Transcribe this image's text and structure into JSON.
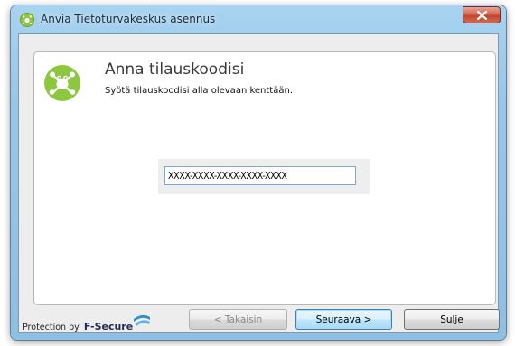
{
  "window": {
    "title": "Anvia Tietoturvakeskus asennus"
  },
  "content": {
    "heading": "Anna tilauskoodisi",
    "subheading": "Syötä tilauskoodisi alla olevaan kenttään.",
    "code_input_value": "XXXX-XXXX-XXXX-XXXX-XXXX"
  },
  "footer": {
    "brand_prefix": "Protection by",
    "brand_name": "F-Secure",
    "buttons": {
      "back": "< Takaisin",
      "next": "Seuraava >",
      "close": "Sulje"
    }
  },
  "icons": [
    "frog-logo",
    "close-icon",
    "f-secure-logo-icon"
  ],
  "colors": {
    "title_bar": "#98c6e8",
    "close_button": "#c2452c",
    "logo_green": "#8dc63f",
    "default_button": "#bee6fd"
  }
}
